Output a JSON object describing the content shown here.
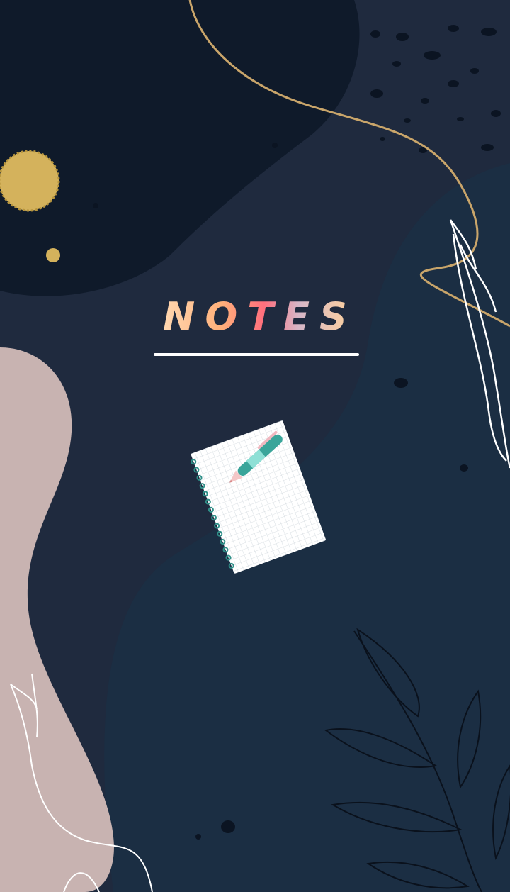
{
  "screen": {
    "title": "NOTES",
    "illustration": "notepad-and-pen",
    "colors": {
      "background": "#1f2a3e",
      "dark_blob": "#0f1a2a",
      "teal_blob": "#1c2f44",
      "pink_blob": "#c8b3b1",
      "gold": "#d4b25c",
      "pen_teal": "#3aa59a",
      "underline": "#ffffff"
    }
  }
}
